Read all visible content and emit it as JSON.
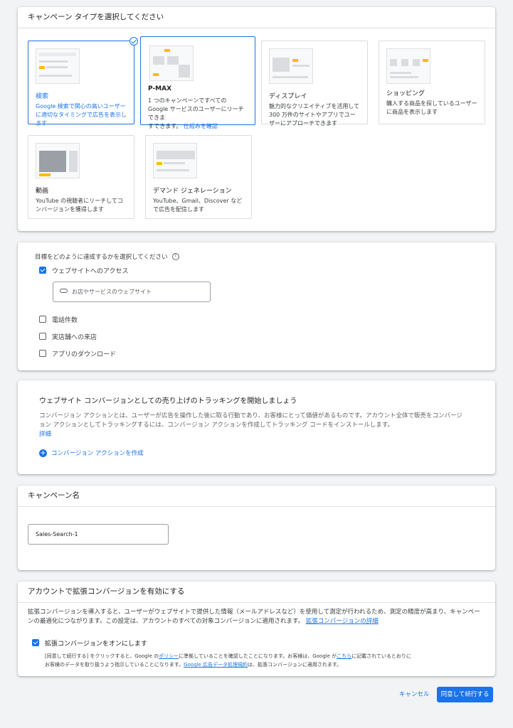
{
  "campaign_type": {
    "title": "キャンペーン タイプを選択してください",
    "tiles": [
      {
        "name": "検索",
        "desc": "Google 検索で関心の高いユーザーに適切なタイミングで広告を表示します"
      },
      {
        "name": "P-MAX",
        "desc": "1 つのキャンペーンですべての Google サービスのユーザーにリーチできま",
        "desc2": "すできます。",
        "link": "仕組みを確認"
      },
      {
        "name": "ディスプレイ",
        "desc": "魅力的なクリエイティブを活用して 300 万件のサイトやアプリでユーザーにアプローチできます"
      },
      {
        "name": "ショッピング",
        "desc": "購入する商品を探しているユーザーに商品を表示します"
      },
      {
        "name": "動画",
        "desc": "YouTube の視聴者にリーチしてコンバージョンを獲得します"
      },
      {
        "name": "デマンド ジェネレーション",
        "desc": "YouTube、Gmail、Discover などで広告を配信します"
      }
    ]
  },
  "goals": {
    "title": "目標をどのように達成するかを選択してください",
    "options": [
      {
        "label": "ウェブサイトへのアクセス",
        "checked": true
      },
      {
        "label": "電話件数",
        "checked": false
      },
      {
        "label": "実店舗への来店",
        "checked": false
      },
      {
        "label": "アプリのダウンロード",
        "checked": false
      }
    ],
    "url_placeholder": "お店やサービスのウェブサイト"
  },
  "conversion": {
    "title": "ウェブサイト コンバージョンとしての売り上げのトラッキングを開始しましょう",
    "body": "コンバージョン アクションとは、ユーザーが広告を操作した後に取る行動であり、お客様にとって価値があるものです。アカウント全体で販売をコンバージョン アクションとしてトラッキングするには、コンバージョン アクションを作成してトラッキング コードをインストールします。",
    "details_link": "詳細",
    "create_action": "コンバージョン アクションを作成"
  },
  "campaign_name": {
    "title": "キャンペーン名",
    "value": "Sales-Search-1"
  },
  "enhanced": {
    "title": "アカウントで拡張コンバージョンを有効にする",
    "body": "拡張コンバージョンを導入すると、ユーザーがウェブサイトで提供した情報（メールアドレスなど）を使用して測定が行われるため、測定の精度が高まり、キャンペーンの最適化につながります。この設定は、アカウントのすべての対象コンバージョンに適用されます。",
    "body_link": "拡張コンバージョンの詳細",
    "checkbox_label": "拡張コンバージョンをオンにします",
    "fine_1": "[同意して続行する] をクリックすると、Google の",
    "fine_policy": "ポリシー",
    "fine_2": "に準拠していることを確認したことになります。お客様は、Google が",
    "fine_here": "こちら",
    "fine_3": "に記載されているとおりにお客様のデータを取り扱うよう指示していることになります。",
    "fine_terms": "Google 広告データ処理規約",
    "fine_4": "は、拡張コンバージョンに適用されます。"
  },
  "footer": {
    "cancel": "キャンセル",
    "agree": "同意して続行する"
  },
  "colors": {
    "accent": "#1a73e8",
    "yellow": "#fbbc04"
  }
}
